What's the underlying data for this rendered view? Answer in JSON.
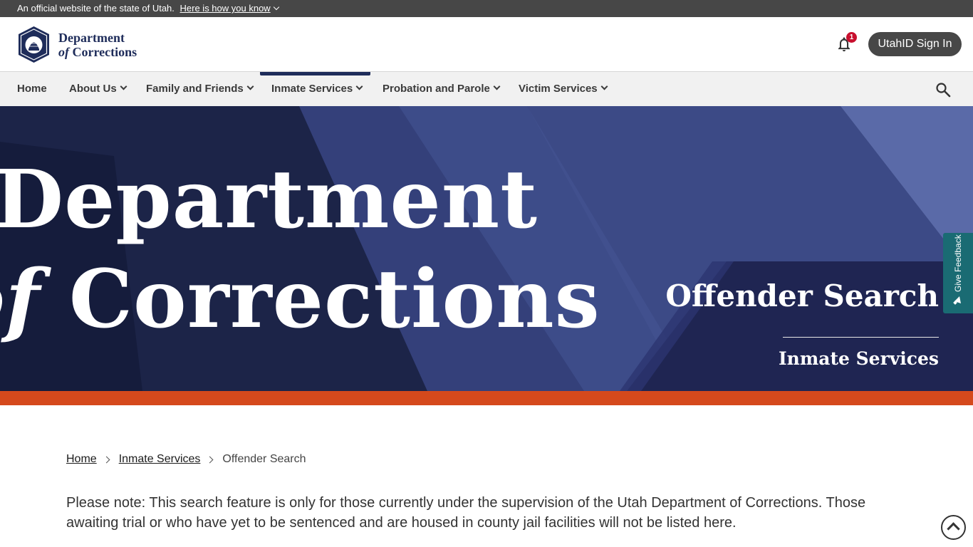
{
  "gov_banner": {
    "text": "An official website of the state of Utah.",
    "link": "Here is how you know"
  },
  "header": {
    "logo": {
      "line1": "Department",
      "line2_of": "of",
      "line2": "Corrections",
      "seal_text": "UTAH",
      "seal_year": "1896"
    },
    "notifications_count": "1",
    "signin_label": "UtahID Sign In"
  },
  "nav": {
    "items": [
      {
        "label": "Home"
      },
      {
        "label": "About Us"
      },
      {
        "label": "Family and Friends"
      },
      {
        "label": "Inmate Services"
      },
      {
        "label": "Probation and Parole"
      },
      {
        "label": "Victim Services"
      }
    ],
    "active": "Inmate Services"
  },
  "hero": {
    "big_line1": "Department",
    "big_line2_of": "of",
    "big_line2": "Corrections",
    "title": "Offender Search",
    "subtitle": "Inmate Services"
  },
  "feedback": {
    "label": "Give Feedback"
  },
  "breadcrumb": {
    "items": [
      "Home",
      "Inmate Services",
      "Offender Search"
    ]
  },
  "main": {
    "note": "Please note: This search feature is only for those currently under the supervision of the Utah Department of Corrections. Those awaiting trial or who have yet to be sentenced and are housed in county jail facilities will not be listed here."
  },
  "colors": {
    "banner_bg": "#474747",
    "nav_bg": "#f1f1f1",
    "hero_navy": "#26305e",
    "accent_orange": "#d5491c",
    "feedback_teal": "#1a6b73",
    "brand_navy": "#1e2c5a"
  },
  "icons": [
    "chevron-down-icon",
    "bell-icon",
    "search-icon",
    "megaphone-icon",
    "chevron-right-icon",
    "arrow-up-icon",
    "state-seal"
  ]
}
